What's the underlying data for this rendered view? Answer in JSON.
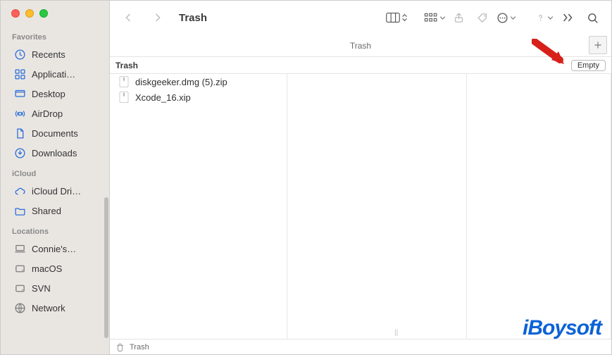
{
  "window": {
    "title": "Trash"
  },
  "sidebar": {
    "sections": [
      {
        "label": "Favorites",
        "items": [
          {
            "icon": "clock-icon",
            "label": "Recents"
          },
          {
            "icon": "grid-icon",
            "label": "Applicati…"
          },
          {
            "icon": "desktop-icon",
            "label": "Desktop"
          },
          {
            "icon": "airdrop-icon",
            "label": "AirDrop"
          },
          {
            "icon": "doc-icon",
            "label": "Documents"
          },
          {
            "icon": "download-icon",
            "label": "Downloads"
          }
        ]
      },
      {
        "label": "iCloud",
        "items": [
          {
            "icon": "cloud-icon",
            "label": "iCloud Dri…"
          },
          {
            "icon": "folder-icon",
            "label": "Shared"
          }
        ]
      },
      {
        "label": "Locations",
        "items": [
          {
            "icon": "laptop-icon",
            "gray": true,
            "label": "Connie's…"
          },
          {
            "icon": "disk-icon",
            "gray": true,
            "label": "macOS"
          },
          {
            "icon": "disk-icon",
            "gray": true,
            "label": "SVN"
          },
          {
            "icon": "globe-icon",
            "gray": true,
            "label": "Network"
          }
        ]
      }
    ]
  },
  "toolbar": {
    "title": "Trash"
  },
  "breadcrumb": {
    "label": "Trash"
  },
  "header": {
    "column_label": "Trash",
    "empty_button": "Empty"
  },
  "files": [
    {
      "name": "diskgeeker.dmg (5).zip"
    },
    {
      "name": "Xcode_16.xip"
    }
  ],
  "pathbar": {
    "label": "Trash"
  },
  "watermark": "iBoysoft"
}
